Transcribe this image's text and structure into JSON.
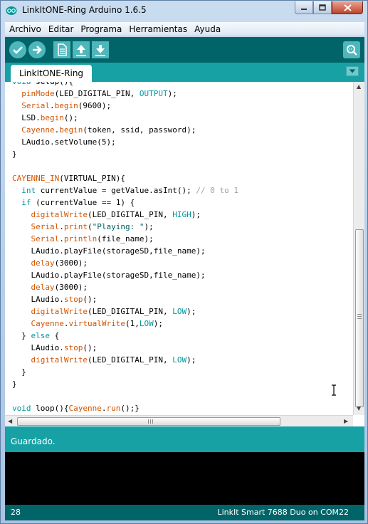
{
  "window": {
    "title": "LinkItONE-Ring Arduino 1.6.5"
  },
  "menu": {
    "items": [
      "Archivo",
      "Editar",
      "Programa",
      "Herramientas",
      "Ayuda"
    ]
  },
  "toolbar": {
    "buttons": [
      "verify-icon",
      "upload-icon",
      "new-icon",
      "open-icon",
      "save-icon"
    ],
    "serial_monitor_icon": "serial-monitor-icon"
  },
  "tabs": [
    {
      "label": "LinkItONE-Ring"
    }
  ],
  "editor": {
    "lines": [
      "void setup(){",
      "  pinMode(LED_DIGITAL_PIN, OUTPUT);",
      "  Serial.begin(9600);",
      "  LSD.begin();",
      "  Cayenne.begin(token, ssid, password);",
      "  LAudio.setVolume(5);",
      "}",
      "",
      "CAYENNE_IN(VIRTUAL_PIN){",
      "  int currentValue = getValue.asInt(); // 0 to 1",
      "  if (currentValue == 1) {",
      "    digitalWrite(LED_DIGITAL_PIN, HIGH);",
      "    Serial.print(\"Playing: \");",
      "    Serial.println(file_name);",
      "    LAudio.playFile(storageSD,file_name);",
      "    delay(3000);",
      "    LAudio.playFile(storageSD,file_name);",
      "    delay(3000);",
      "    LAudio.stop();",
      "    digitalWrite(LED_DIGITAL_PIN, LOW);",
      "    Cayenne.virtualWrite(1,LOW);",
      "  } else {",
      "    LAudio.stop();",
      "    digitalWrite(LED_DIGITAL_PIN, LOW);",
      "  }",
      "}",
      "",
      "void loop(){Cayenne.run();}"
    ]
  },
  "status": {
    "message": "Guardado."
  },
  "footer": {
    "line_number": "28",
    "board": "LinkIt Smart 7688 Duo on COM22"
  },
  "colors": {
    "toolbar": "#006468",
    "tabbar": "#17a1a5",
    "keyword_fn": "#d35400",
    "keyword_const": "#00979c",
    "comment": "#95a5a6"
  }
}
